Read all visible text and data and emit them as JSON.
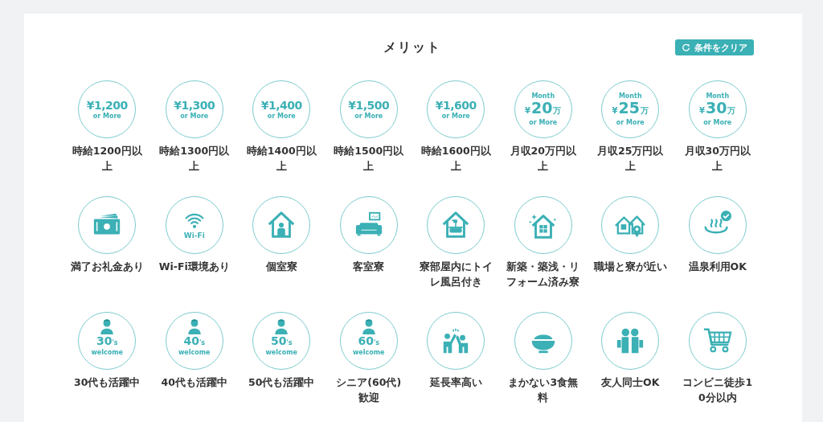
{
  "title": "メリット",
  "clear_button": {
    "label": "条件をクリア"
  },
  "merits": [
    {
      "kind": "hourly",
      "amount": "¥1,200",
      "note": "or More",
      "label": "時給1200円以上"
    },
    {
      "kind": "hourly",
      "amount": "¥1,300",
      "note": "or More",
      "label": "時給1300円以上"
    },
    {
      "kind": "hourly",
      "amount": "¥1,400",
      "note": "or More",
      "label": "時給1400円以上"
    },
    {
      "kind": "hourly",
      "amount": "¥1,500",
      "note": "or More",
      "label": "時給1500円以上"
    },
    {
      "kind": "hourly",
      "amount": "¥1,600",
      "note": "or More",
      "label": "時給1600円以上"
    },
    {
      "kind": "monthly",
      "period": "Month",
      "currency": "¥",
      "amount": "20",
      "unit": "万",
      "note": "or More",
      "label": "月収20万円以上"
    },
    {
      "kind": "monthly",
      "period": "Month",
      "currency": "¥",
      "amount": "25",
      "unit": "万",
      "note": "or More",
      "label": "月収25万円以上"
    },
    {
      "kind": "monthly",
      "period": "Month",
      "currency": "¥",
      "amount": "30",
      "unit": "万",
      "note": "or More",
      "label": "月収30万円以上"
    },
    {
      "kind": "money",
      "label": "満了お礼金あり"
    },
    {
      "kind": "wifi",
      "caption": "Wi-Fi",
      "label": "Wi-Fi環境あり"
    },
    {
      "kind": "house-person",
      "label": "個室寮"
    },
    {
      "kind": "sofa",
      "label": "客室寮"
    },
    {
      "kind": "house-bath",
      "label": "寮部屋内にトイレ風呂付き"
    },
    {
      "kind": "house-sparkle",
      "label": "新築・築浅・リフォーム済み寮"
    },
    {
      "kind": "houses-pin",
      "label": "職場と寮が近い"
    },
    {
      "kind": "hot-spring",
      "label": "温泉利用OK"
    },
    {
      "kind": "age",
      "decade": "30",
      "suffix": "'s",
      "note": "welcome",
      "label": "30代も活躍中"
    },
    {
      "kind": "age",
      "decade": "40",
      "suffix": "'s",
      "note": "welcome",
      "label": "40代も活躍中"
    },
    {
      "kind": "age",
      "decade": "50",
      "suffix": "'s",
      "note": "welcome",
      "label": "50代も活躍中"
    },
    {
      "kind": "age",
      "decade": "60",
      "suffix": "'s",
      "note": "welcome",
      "label": "シニア(60代)歓迎"
    },
    {
      "kind": "high-five",
      "label": "延長率高い"
    },
    {
      "kind": "rice-bowl",
      "label": "まかない3食無料"
    },
    {
      "kind": "friends",
      "label": "友人同士OK"
    },
    {
      "kind": "cart",
      "label": "コンビニ徒歩10分以内"
    }
  ]
}
